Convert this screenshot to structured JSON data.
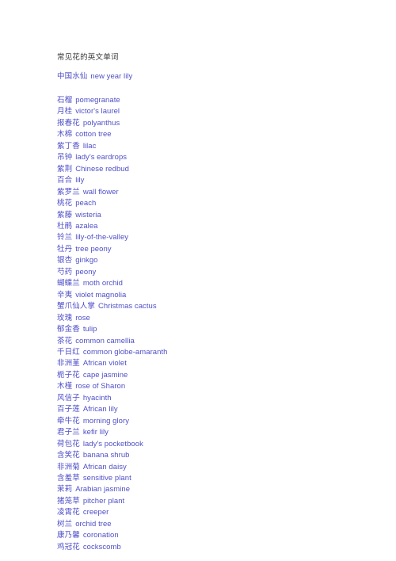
{
  "document": {
    "title": "常见花的英文单词",
    "lead_entry": {
      "chinese": "中国水仙",
      "english": "new year lily"
    },
    "text_color": "#5050c8",
    "title_color": "#3a3a3a",
    "background_color": "#ffffff",
    "entries": [
      {
        "chinese": "石榴",
        "english": "pomegranate"
      },
      {
        "chinese": "月桂",
        "english": "victor's laurel"
      },
      {
        "chinese": "报春花",
        "english": "polyanthus"
      },
      {
        "chinese": "木棉",
        "english": "cotton tree"
      },
      {
        "chinese": "紫丁香",
        "english": "lilac"
      },
      {
        "chinese": "吊钟",
        "english": "lady's eardrops"
      },
      {
        "chinese": "紫荆",
        "english": "Chinese redbud"
      },
      {
        "chinese": "百合",
        "english": "lily"
      },
      {
        "chinese": "紫罗兰",
        "english": "wall flower"
      },
      {
        "chinese": "桃花",
        "english": "peach"
      },
      {
        "chinese": "紫藤",
        "english": "wisteria"
      },
      {
        "chinese": "杜鹃",
        "english": "azalea"
      },
      {
        "chinese": "铃兰",
        "english": "lily-of-the-valley"
      },
      {
        "chinese": "牡丹",
        "english": "tree peony"
      },
      {
        "chinese": "银杏",
        "english": "ginkgo"
      },
      {
        "chinese": "芍药",
        "english": "peony"
      },
      {
        "chinese": "蝴蝶兰",
        "english": "moth orchid"
      },
      {
        "chinese": "辛夷",
        "english": "violet magnolia"
      },
      {
        "chinese": "蟹爪仙人掌",
        "english": "Christmas cactus"
      },
      {
        "chinese": "玫瑰",
        "english": "rose"
      },
      {
        "chinese": "郁金香",
        "english": "tulip"
      },
      {
        "chinese": "茶花",
        "english": "common camellia"
      },
      {
        "chinese": "千日红",
        "english": "common globe-amaranth"
      },
      {
        "chinese": "非洲堇",
        "english": "African violet"
      },
      {
        "chinese": "栀子花",
        "english": "cape jasmine"
      },
      {
        "chinese": "木槿",
        "english": "rose of Sharon"
      },
      {
        "chinese": "风信子",
        "english": "hyacinth"
      },
      {
        "chinese": "百子莲",
        "english": "African lily"
      },
      {
        "chinese": "牵牛花",
        "english": "morning glory"
      },
      {
        "chinese": "君子兰",
        "english": "kefir lily"
      },
      {
        "chinese": "荷包花",
        "english": "lady's pocketbook"
      },
      {
        "chinese": "含笑花",
        "english": "banana shrub"
      },
      {
        "chinese": "非洲菊",
        "english": "African daisy"
      },
      {
        "chinese": "含羞草",
        "english": "sensitive plant"
      },
      {
        "chinese": "茉莉",
        "english": "Arabian jasmine"
      },
      {
        "chinese": "猪笼草",
        "english": "pitcher plant"
      },
      {
        "chinese": "凌霄花",
        "english": "creeper"
      },
      {
        "chinese": "树兰",
        "english": "orchid tree"
      },
      {
        "chinese": "康乃馨",
        "english": "coronation"
      },
      {
        "chinese": "鸡冠花",
        "english": "cockscomb"
      }
    ]
  }
}
